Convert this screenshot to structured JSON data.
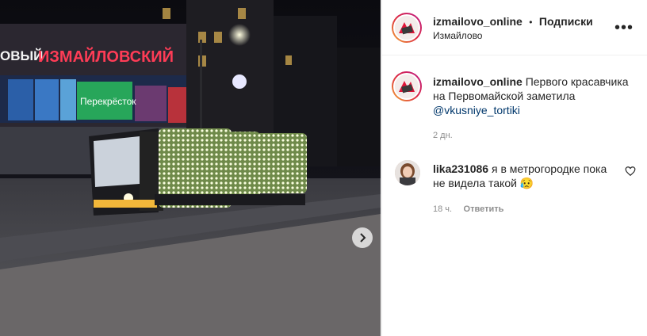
{
  "post": {
    "photo_alt": "tram photo",
    "storefront_text": "ИЗМАЙЛОВСКИЙ",
    "storefront_prefix": "ОВЫЙ",
    "shop_label": "Перекрёсток"
  },
  "header": {
    "username": "izmailovo_online",
    "separator": "•",
    "follow_label": "Подписки",
    "location": "Измайлово",
    "more_icon": "more-horizontal-icon"
  },
  "caption": {
    "username": "izmailovo_online",
    "text": "Первого красавчика на Первомайской заметила",
    "mention": "@vkusniye_tortiki",
    "time": "2 дн."
  },
  "comment": {
    "username": "lika231086",
    "text": "я в метрогородке пока не видела такой",
    "emoji": "😥",
    "time": "18 ч.",
    "reply_label": "Ответить",
    "like_icon": "heart-icon"
  },
  "colors": {
    "accent_red": "#e0163a",
    "link": "#00376b",
    "muted": "#8e8e8e"
  }
}
